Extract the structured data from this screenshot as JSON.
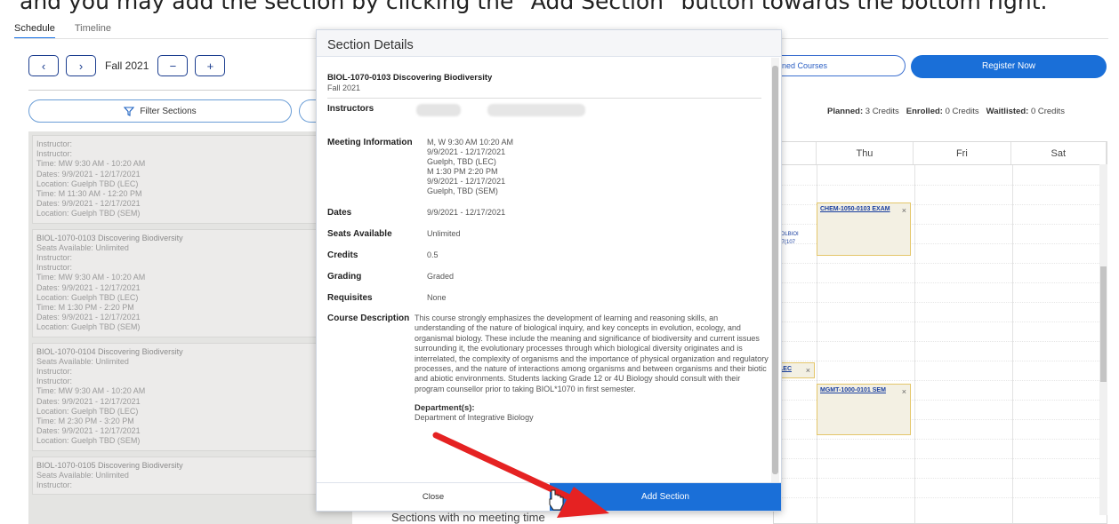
{
  "caption": "and you may add the section by clicking the \"Add Section\" button towards the bottom right.",
  "tabs": [
    "Schedule",
    "Timeline"
  ],
  "term_nav": {
    "term": "Fall 2021",
    "minus": "−",
    "plus": "+"
  },
  "filter_label": "Filter Sections",
  "planned_label": "nned Courses",
  "register_label": "Register Now",
  "credits": {
    "planned_label": "Planned:",
    "planned_value": "3 Credits",
    "enrolled_label": "Enrolled:",
    "enrolled_value": "0 Credits",
    "waitlisted_label": "Waitlisted:",
    "waitlisted_value": "0 Credits"
  },
  "calendar": {
    "days": [
      "Thu",
      "Fri",
      "Sat"
    ],
    "events": [
      "CHEM-1050-0103 EXAM",
      "MGMT-1000-0101 SEM",
      "LEC"
    ],
    "partial": [
      "BIOLBIOI",
      "107(107"
    ]
  },
  "left_sections": [
    {
      "lines": [
        "Instructor:",
        "Instructor:",
        "Time: MW 9:30 AM - 10:20 AM",
        "Dates: 9/9/2021 - 12/17/2021",
        "Location: Guelph TBD (LEC)",
        "Time: M 11:30 AM - 12:20 PM",
        "Dates: 9/9/2021 - 12/17/2021",
        "Location: Guelph TBD (SEM)"
      ]
    },
    {
      "lines": [
        "BIOL-1070-0103 Discovering Biodiversity",
        "Seats Available: Unlimited",
        "Instructor:",
        "Instructor:",
        "Time: MW 9:30 AM - 10:20 AM",
        "Dates: 9/9/2021 - 12/17/2021",
        "Location: Guelph TBD (LEC)",
        "Time: M 1:30 PM - 2:20 PM",
        "Dates: 9/9/2021 - 12/17/2021",
        "Location: Guelph TBD (SEM)"
      ]
    },
    {
      "lines": [
        "BIOL-1070-0104 Discovering Biodiversity",
        "Seats Available: Unlimited",
        "Instructor:",
        "Instructor:",
        "Time: MW 9:30 AM - 10:20 AM",
        "Dates: 9/9/2021 - 12/17/2021",
        "Location: Guelph TBD (LEC)",
        "Time: M 2:30 PM - 3:20 PM",
        "Dates: 9/9/2021 - 12/17/2021",
        "Location: Guelph TBD (SEM)"
      ]
    },
    {
      "lines": [
        "BIOL-1070-0105 Discovering Biodiversity",
        "Seats Available: Unlimited",
        "Instructor:"
      ]
    }
  ],
  "no_meeting": "Sections with no meeting time",
  "modal": {
    "title": "Section Details",
    "course": "BIOL-1070-0103 Discovering Biodiversity",
    "term": "Fall 2021",
    "labels": {
      "instructors": "Instructors",
      "meeting": "Meeting Information",
      "dates": "Dates",
      "seats": "Seats Available",
      "credits": "Credits",
      "grading": "Grading",
      "requisites": "Requisites",
      "description": "Course Description"
    },
    "meeting_lines": [
      "M, W 9:30 AM 10:20 AM",
      "9/9/2021 - 12/17/2021",
      "Guelph, TBD (LEC)",
      "M 1:30 PM 2:20 PM",
      "9/9/2021 - 12/17/2021",
      "Guelph, TBD (SEM)"
    ],
    "dates": "9/9/2021 - 12/17/2021",
    "seats": "Unlimited",
    "credits": "0.5",
    "grading": "Graded",
    "requisites": "None",
    "description": "This course strongly emphasizes the development of learning and reasoning skills, an understanding of the nature of biological inquiry, and key concepts in evolution, ecology, and organismal biology. These include the meaning and significance of biodiversity and current issues surrounding it, the evolutionary processes through which biological diversity originates and is interrelated, the complexity of organisms and the importance of physical organization and regulatory processes, and the nature of interactions among organisms and between organisms and their biotic and abiotic environments. Students lacking Grade 12 or 4U Biology should consult with their program counsellor prior to taking BIOL*1070 in first semester.",
    "dept_label": "Department(s):",
    "dept_value": "Department of Integrative Biology",
    "close": "Close",
    "add": "Add Section"
  }
}
